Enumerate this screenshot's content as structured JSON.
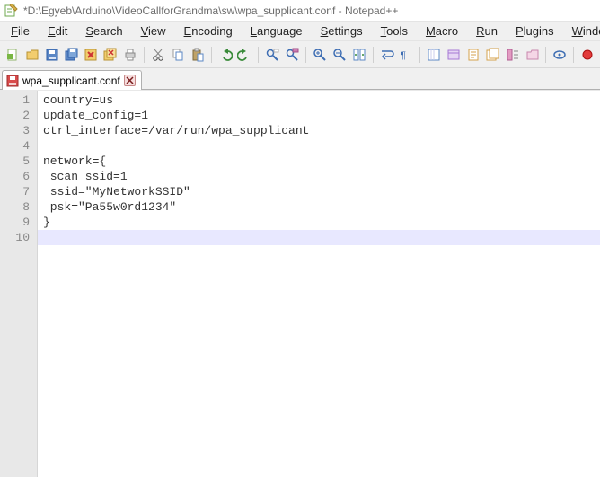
{
  "title": "*D:\\Egyeb\\Arduino\\VideoCallforGrandma\\sw\\wpa_supplicant.conf - Notepad++",
  "menu": {
    "file": {
      "u": "F",
      "rest": "ile"
    },
    "edit": {
      "u": "E",
      "rest": "dit"
    },
    "search": {
      "u": "S",
      "rest": "earch"
    },
    "view": {
      "u": "V",
      "rest": "iew"
    },
    "encoding": {
      "u": "E",
      "rest": "ncoding"
    },
    "language": {
      "u": "L",
      "rest": "anguage"
    },
    "settings": {
      "u": "S",
      "rest": "ettings"
    },
    "tools": {
      "u": "T",
      "rest": "ools"
    },
    "macro": {
      "u": "M",
      "rest": "acro"
    },
    "run": {
      "u": "R",
      "rest": "un"
    },
    "plugins": {
      "u": "P",
      "rest": "lugins"
    },
    "window": {
      "u": "W",
      "rest": "indow"
    },
    "help": {
      "u": "?",
      "rest": ""
    }
  },
  "tab": {
    "label": "wpa_supplicant.conf"
  },
  "lines": [
    "country=us",
    "update_config=1",
    "ctrl_interface=/var/run/wpa_supplicant",
    "",
    "network={",
    " scan_ssid=1",
    " ssid=\"MyNetworkSSID\"",
    " psk=\"Pa55w0rd1234\"",
    "}",
    ""
  ],
  "current_line_index": 9
}
